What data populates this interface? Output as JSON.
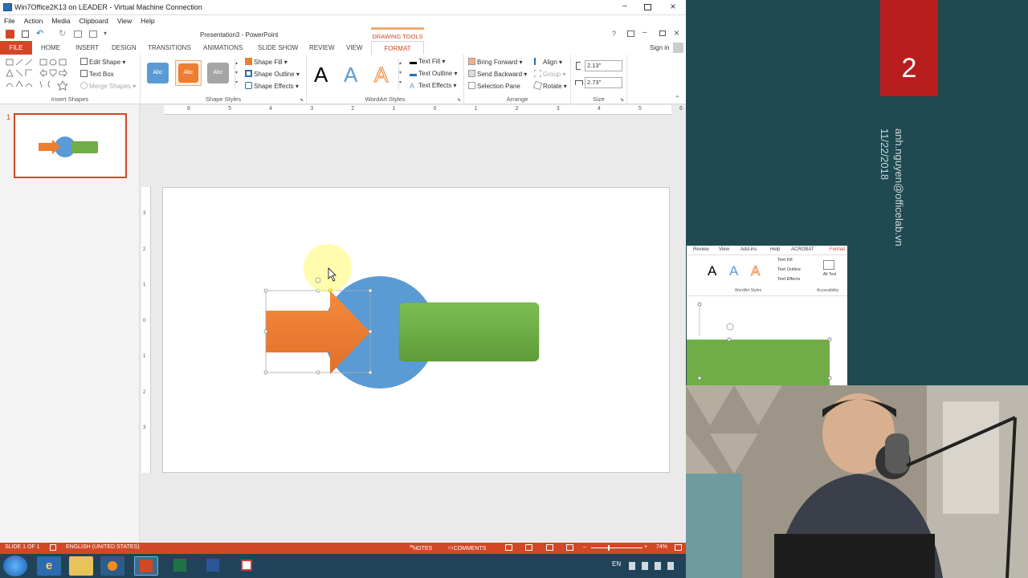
{
  "vm": {
    "title": "Win7Office2K13 on LEADER - Virtual Machine Connection",
    "menu": [
      "File",
      "Action",
      "Media",
      "Clipboard",
      "View",
      "Help"
    ]
  },
  "ppt": {
    "title": "Presentation3 - PowerPoint",
    "drawing_tools": "DRAWING TOOLS",
    "sign_in": "Sign in",
    "tabs": [
      "FILE",
      "HOME",
      "INSERT",
      "DESIGN",
      "TRANSITIONS",
      "ANIMATIONS",
      "SLIDE SHOW",
      "REVIEW",
      "VIEW",
      "FORMAT"
    ],
    "ribbon": {
      "edit_shape": "Edit Shape",
      "text_box": "Text Box",
      "merge_shapes": "Merge Shapes",
      "insert_shapes_label": "Insert Shapes",
      "style_swatch_text": "Abc",
      "shape_fill": "Shape Fill",
      "shape_outline": "Shape Outline",
      "shape_effects": "Shape Effects",
      "shape_styles_label": "Shape Styles",
      "wordart_letter": "A",
      "text_fill": "Text Fill",
      "text_outline": "Text Outline",
      "text_effects": "Text Effects",
      "wordart_label": "WordArt Styles",
      "bring_forward": "Bring Forward",
      "send_backward": "Send Backward",
      "selection_pane": "Selection Pane",
      "align": "Align",
      "group": "Group",
      "rotate": "Rotate",
      "arrange_label": "Arrange",
      "height": "2.13\"",
      "width": "2.73\"",
      "size_label": "Size"
    },
    "ruler_numbers": [
      "6",
      "5",
      "4",
      "3",
      "2",
      "1",
      "0",
      "1",
      "2",
      "3",
      "4",
      "5",
      "6"
    ],
    "vruler_numbers": [
      "3",
      "2",
      "1",
      "0",
      "1",
      "2",
      "3"
    ],
    "slide_number": "1",
    "status": {
      "slide": "SLIDE 1 OF 1",
      "language": "ENGLISH (UNITED STATES)",
      "notes": "NOTES",
      "comments": "COMMENTS",
      "zoom": "74%"
    },
    "tray_lang": "EN"
  },
  "overlay": {
    "big_number": "2",
    "email": "anh.nguyen@officelab.vn",
    "date": "11/22/2018"
  },
  "preview": {
    "tabs": [
      "Review",
      "View",
      "Add-ins",
      "Help",
      "ACROBAT",
      "Format"
    ],
    "text_fill": "Text Fill",
    "text_outline": "Text Outline",
    "text_effects": "Text Effects",
    "alt_text": "Alt Text",
    "wordart_label": "WordArt Styles",
    "accessibility_label": "Accessibility"
  },
  "colors": {
    "accent": "#d24726",
    "orange": "#ed7d31",
    "blue": "#5b9bd5",
    "green": "#70ad47",
    "gray": "#a5a5a5"
  }
}
